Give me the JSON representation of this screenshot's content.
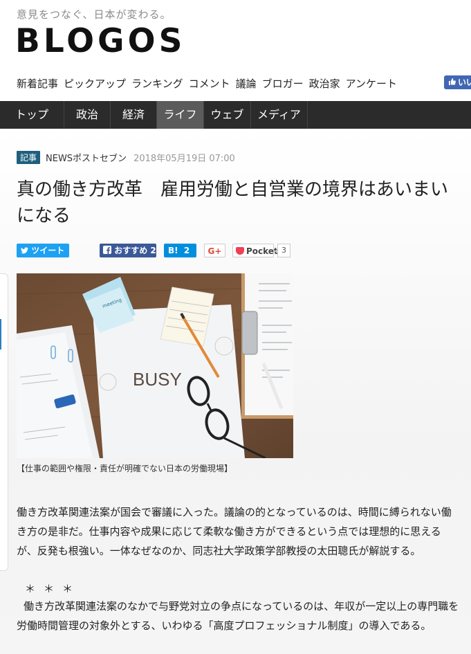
{
  "header": {
    "tagline": "意見をつなぐ、日本が変わる。",
    "logo": "BLOGOS",
    "subnav": [
      "新着記事",
      "ピックアップ",
      "ランキング",
      "コメント",
      "議論",
      "ブロガー",
      "政治家",
      "アンケート"
    ],
    "fb_like_label": "いいね"
  },
  "nav": {
    "items": [
      "トップ",
      "政治",
      "経済",
      "ライフ",
      "ウェブ",
      "メディア"
    ],
    "active": "ライフ"
  },
  "article": {
    "badge": "記事",
    "source": "NEWSポストセブン",
    "date": "2018年05月19日 07:00",
    "title": "真の働き方改革　雇用労働と自営業の境界はあいまいになる",
    "share": {
      "tweet": "ツイート",
      "fb": "おすすめ",
      "fb_count": "2",
      "hatena_icon": "B!",
      "hatena_count": "2",
      "gplus": "G+",
      "pocket": "Pocket",
      "pocket_count": "3"
    },
    "image_text": {
      "busy": "BUSY",
      "sticky": "meeting"
    },
    "caption": "【仕事の範囲や権限・責任が明確でない日本の労働現場】",
    "paragraph1": "働き方改革関連法案が国会で審議に入った。議論の的となっているのは、時間に縛られない働き方の是非だ。仕事内容や成果に応じて柔軟な働き方ができるという点では理想的に思えるが、反発も根強い。一体なぜなのか、同志社大学政策学部教授の太田聰氏が解説する。",
    "separator": "＊＊＊",
    "paragraph2": "働き方改革関連法案のなかで与野党対立の争点になっているのは、年収が一定以上の専門職を労働時間管理の対象外とする、いわゆる「高度プロフェッショナル制度」の導入である。"
  },
  "colors": {
    "nav_bg": "#2b2b2b",
    "nav_active": "#5b5b5b",
    "badge": "#1f5f7e",
    "twitter": "#1da1f2",
    "facebook": "#3b5998",
    "hatena": "#008fde",
    "pocket": "#ef4056"
  }
}
